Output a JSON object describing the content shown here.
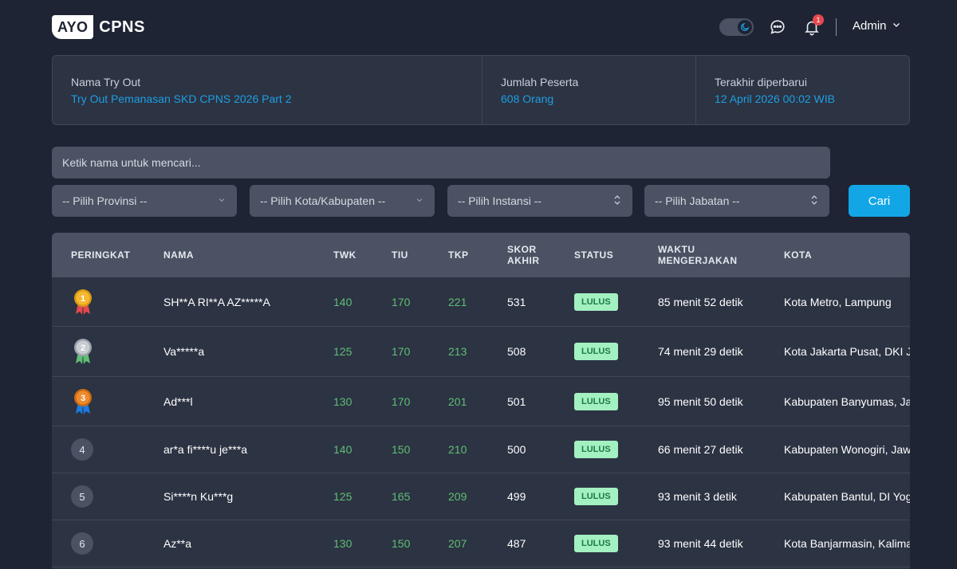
{
  "header": {
    "logo_box": "AYO",
    "logo_text": "CPNS",
    "notification_count": "1",
    "user_label": "Admin"
  },
  "info": {
    "name_label": "Nama Try Out",
    "name_value": "Try Out Pemanasan SKD CPNS 2026 Part 2",
    "participants_label": "Jumlah Peserta",
    "participants_value": "608 Orang",
    "updated_label": "Terakhir diperbarui",
    "updated_value": "12 April 2026 00:02 WIB"
  },
  "search": {
    "placeholder": "Ketik nama untuk mencari..."
  },
  "filters": {
    "provinsi": "-- Pilih Provinsi --",
    "kota": "-- Pilih Kota/Kabupaten --",
    "instansi": "-- Pilih Instansi --",
    "jabatan": "-- Pilih Jabatan --",
    "search_button": "Cari"
  },
  "table": {
    "headers": {
      "rank": "PERINGKAT",
      "name": "NAMA",
      "twk": "TWK",
      "tiu": "TIU",
      "tkp": "TKP",
      "score1": "SKOR",
      "score2": "AKHIR",
      "status": "STATUS",
      "time1": "WAKTU",
      "time2": "MENGERJAKAN",
      "city": "KOTA"
    },
    "rows": [
      {
        "rank": "1",
        "name": "SH**A RI**A AZ*****A",
        "twk": "140",
        "tiu": "170",
        "tkp": "221",
        "score": "531",
        "status": "LULUS",
        "time": "85 menit 52 detik",
        "city": "Kota Metro, Lampung"
      },
      {
        "rank": "2",
        "name": "Va*****a",
        "twk": "125",
        "tiu": "170",
        "tkp": "213",
        "score": "508",
        "status": "LULUS",
        "time": "74 menit 29 detik",
        "city": "Kota Jakarta Pusat, DKI Jakarta"
      },
      {
        "rank": "3",
        "name": "Ad***l",
        "twk": "130",
        "tiu": "170",
        "tkp": "201",
        "score": "501",
        "status": "LULUS",
        "time": "95 menit 50 detik",
        "city": "Kabupaten Banyumas, Jawa Tengah"
      },
      {
        "rank": "4",
        "name": "ar*a fi****u je***a",
        "twk": "140",
        "tiu": "150",
        "tkp": "210",
        "score": "500",
        "status": "LULUS",
        "time": "66 menit 27 detik",
        "city": "Kabupaten Wonogiri, Jawa Tengah"
      },
      {
        "rank": "5",
        "name": "Si****n Ku***g",
        "twk": "125",
        "tiu": "165",
        "tkp": "209",
        "score": "499",
        "status": "LULUS",
        "time": "93 menit 3 detik",
        "city": "Kabupaten Bantul, DI Yogyakarta"
      },
      {
        "rank": "6",
        "name": "Az**a",
        "twk": "130",
        "tiu": "150",
        "tkp": "207",
        "score": "487",
        "status": "LULUS",
        "time": "93 menit 44 detik",
        "city": "Kota Banjarmasin, Kalimantan Selatan"
      }
    ]
  }
}
